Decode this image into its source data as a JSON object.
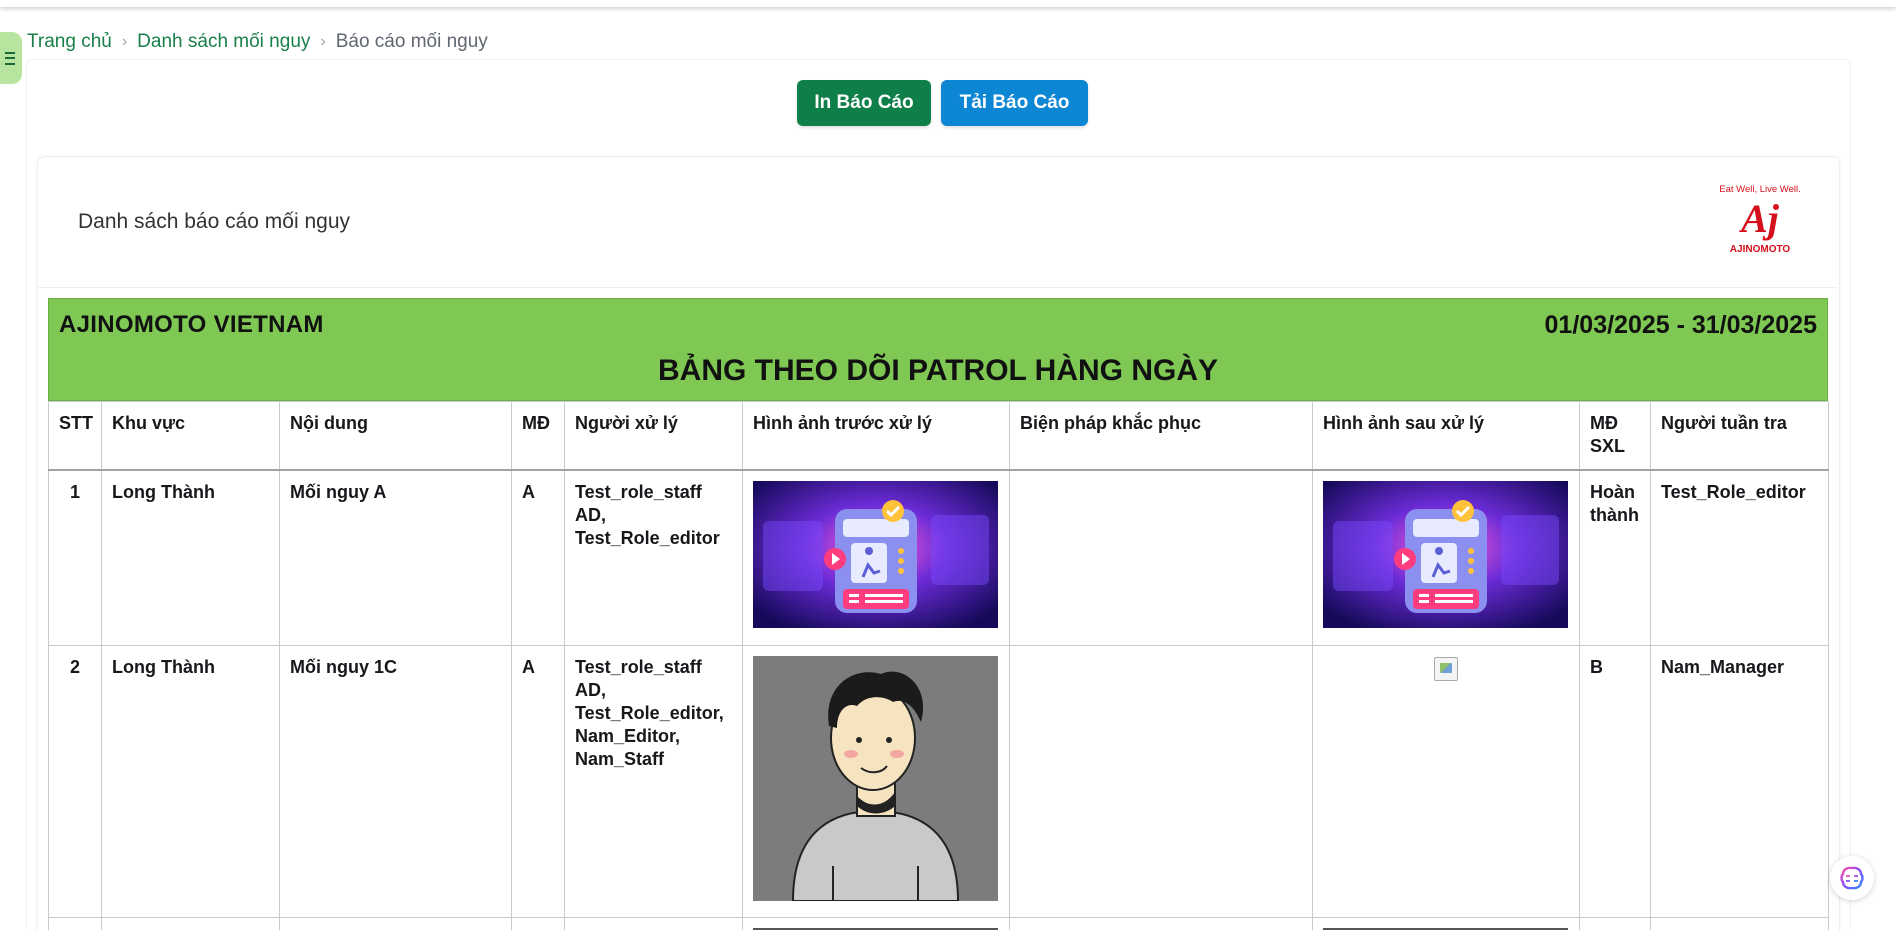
{
  "breadcrumb": {
    "home": "Trang chủ",
    "list": "Danh sách mối nguy",
    "current": "Báo cáo mối nguy"
  },
  "actions": {
    "print_label": "In Báo Cáo",
    "download_label": "Tải Báo Cáo"
  },
  "report": {
    "card_title": "Danh sách báo cáo mối nguy",
    "logo": {
      "tagline": "Eat Well, Live Well.",
      "mark": "Aj",
      "brand": "AJINOMOTO",
      "color": "#d5101d"
    },
    "company": "AJINOMOTO  VIETNAM",
    "date_range": "01/03/2025 - 31/03/2025",
    "sheet_title": "BẢNG THEO DÕI PATROL HÀNG NGÀY",
    "header_color": "#7ec853"
  },
  "table": {
    "headers": {
      "stt": "STT",
      "area": "Khu vực",
      "content": "Nội dung",
      "level": "MĐ",
      "handler": "Người xử lý",
      "img_before": "Hình ảnh trước xử lý",
      "measure": "Biện pháp khắc phục",
      "img_after": "Hình ảnh sau xử lý",
      "level_after": "MĐ SXL",
      "patroller": "Người tuần tra"
    },
    "rows": [
      {
        "stt": "1",
        "area": "Long Thành",
        "content": "Mối nguy A",
        "level": "A",
        "handler": "Test_role_staff AD, Test_Role_editor",
        "img_before": "hazard-photo-illustration",
        "measure": "",
        "img_after": "hazard-photo-illustration",
        "level_after": "Hoàn thành",
        "patroller": "Test_Role_editor"
      },
      {
        "stt": "2",
        "area": "Long Thành",
        "content": "Mối nguy 1C",
        "level": "A",
        "handler": "Test_role_staff AD, Test_Role_editor, Nam_Editor, Nam_Staff",
        "img_before": "person-avatar-photo",
        "measure": "",
        "img_after": "broken-image",
        "level_after": "B",
        "patroller": "Nam_Manager"
      }
    ]
  },
  "colors": {
    "primary_green": "#0f7f4a",
    "primary_blue": "#0d86d4",
    "link_green": "#198049"
  }
}
